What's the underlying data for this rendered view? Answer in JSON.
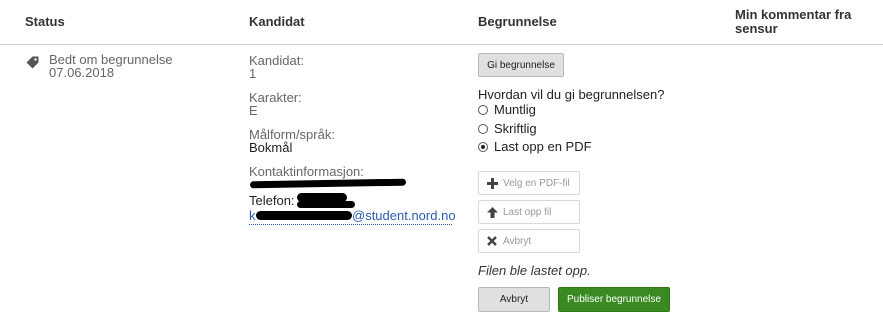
{
  "table": {
    "headers": {
      "status": "Status",
      "kandidat": "Kandidat",
      "begrunnelse": "Begrunnelse",
      "kommentar": "Min kommentar fra sensur"
    },
    "status": {
      "icon": "tag-icon",
      "text": "Bedt om begrunnelse",
      "date": "07.06.2018"
    },
    "candidate": {
      "kandidat_label": "Kandidat:",
      "kandidat_value": "1",
      "karakter_label": "Karakter:",
      "karakter_value": "E",
      "malform_label": "Målform/språk:",
      "malform_value": "Bokmål",
      "kontakt_label": "Kontaktinformasjon:",
      "telefon_label": "Telefon:",
      "email_visible": "@student.nord.no",
      "email_prefix_visible": "k"
    },
    "begrunnelse": {
      "gi_button": "Gi begrunnelse",
      "question": "Hvordan vil du gi begrunnelsen?",
      "options": [
        {
          "label": "Muntlig",
          "selected": false
        },
        {
          "label": "Skriftlig",
          "selected": false
        },
        {
          "label": "Last opp en PDF",
          "selected": true
        }
      ],
      "velg_button": "Velg en PDF-fil",
      "last_opp_button": "Last opp fil",
      "avbryt_small_button": "Avbryt",
      "upload_status": "Filen ble lastet opp.",
      "avbryt_button": "Avbryt",
      "publiser_button": "Publiser begrunnelse"
    }
  },
  "colors": {
    "accent_green": "#3a8a22",
    "link_blue": "#2a5db0"
  }
}
